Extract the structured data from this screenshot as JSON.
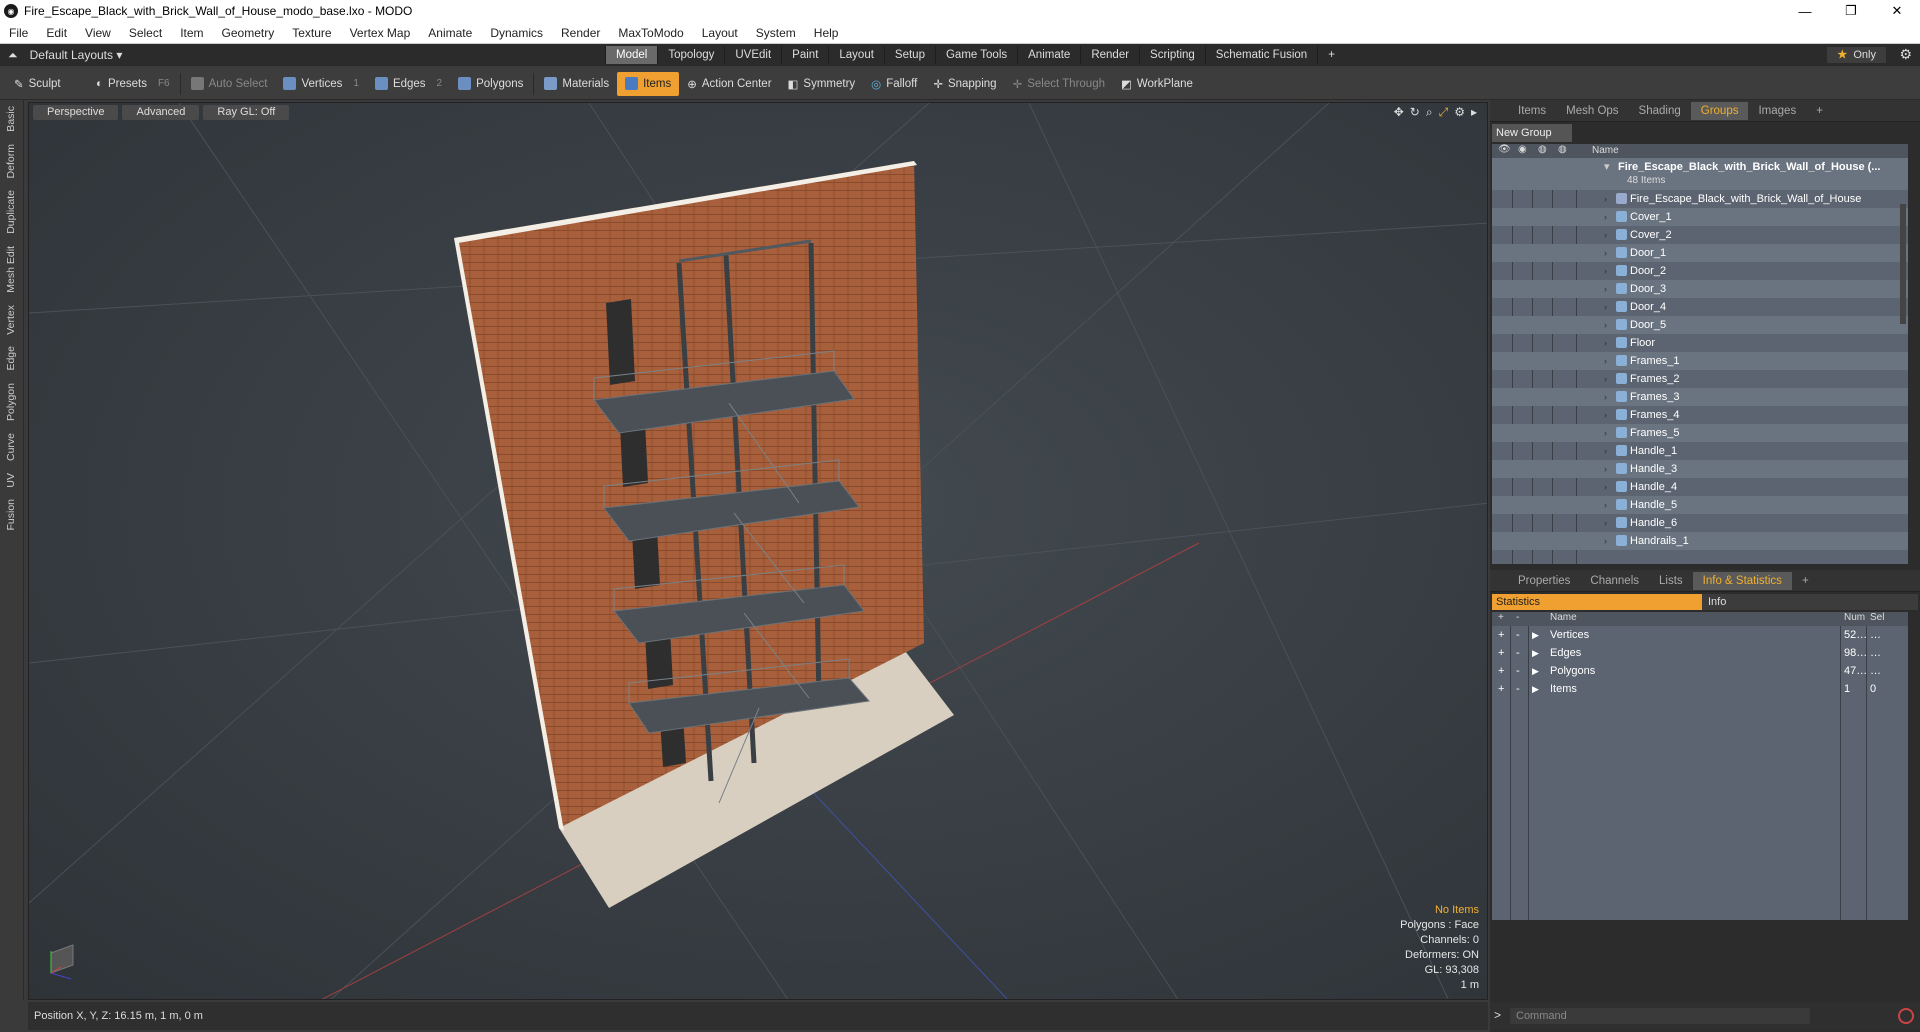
{
  "window": {
    "title": "Fire_Escape_Black_with_Brick_Wall_of_House_modo_base.lxo - MODO",
    "app_icon": "modo-icon",
    "controls": [
      "—",
      "❐",
      "✕"
    ]
  },
  "menu": [
    "File",
    "Edit",
    "View",
    "Select",
    "Item",
    "Geometry",
    "Texture",
    "Vertex Map",
    "Animate",
    "Dynamics",
    "Render",
    "MaxToModo",
    "Layout",
    "System",
    "Help"
  ],
  "layout": {
    "selector": "Default Layouts ▾",
    "tabs": [
      "Model",
      "Topology",
      "UVEdit",
      "Paint",
      "Layout",
      "Setup",
      "Game Tools",
      "Animate",
      "Render",
      "Scripting",
      "Schematic Fusion",
      "+"
    ],
    "active_tab": "Model",
    "only_label": "Only"
  },
  "toolbar": {
    "sculpt": "Sculpt",
    "presets": "Presets",
    "presets_key": "F6",
    "auto_select": "Auto Select",
    "vertices": "Vertices",
    "vertices_key": "1",
    "edges": "Edges",
    "edges_key": "2",
    "polygons": "Polygons",
    "materials": "Materials",
    "items": "Items",
    "action_center": "Action Center",
    "symmetry": "Symmetry",
    "falloff": "Falloff",
    "snapping": "Snapping",
    "select_through": "Select Through",
    "workplane": "WorkPlane"
  },
  "left_tabs": [
    "Basic",
    "Deform",
    "Duplicate",
    "Mesh Edit",
    "Vertex",
    "Edge",
    "Polygon",
    "Curve",
    "UV",
    "Fusion"
  ],
  "viewport": {
    "header": [
      "Perspective",
      "Advanced",
      "Ray GL: Off"
    ],
    "info": {
      "no_items": "No Items",
      "polygons": "Polygons : Face",
      "channels": "Channels: 0",
      "deformers": "Deformers: ON",
      "gl": "GL: 93,308",
      "scale": "1 m"
    }
  },
  "status": {
    "position": "Position X, Y, Z:   16.15 m, 1 m, 0 m"
  },
  "right_top": {
    "tabs": [
      "Items",
      "Mesh Ops",
      "Shading",
      "Groups",
      "Images",
      "+"
    ],
    "active_tab": "Groups",
    "new_group": "New Group",
    "name_col": "Name",
    "root": {
      "name": "Fire_Escape_Black_with_Brick_Wall_of_House (...",
      "count": "48 Items"
    },
    "items": [
      "Fire_Escape_Black_with_Brick_Wall_of_House",
      "Cover_1",
      "Cover_2",
      "Door_1",
      "Door_2",
      "Door_3",
      "Door_4",
      "Door_5",
      "Floor",
      "Frames_1",
      "Frames_2",
      "Frames_3",
      "Frames_4",
      "Frames_5",
      "Handle_1",
      "Handle_3",
      "Handle_4",
      "Handle_5",
      "Handle_6",
      "Handrails_1"
    ]
  },
  "right_bottom": {
    "tabs": [
      "Properties",
      "Channels",
      "Lists",
      "Info & Statistics",
      "+"
    ],
    "active_tab": "Info & Statistics",
    "sub_tabs": [
      "Statistics",
      "Info"
    ],
    "cols": [
      "Name",
      "Num",
      "Sel"
    ],
    "rows": [
      {
        "name": "Vertices",
        "num": "52…",
        "sel": "…"
      },
      {
        "name": "Edges",
        "num": "98…",
        "sel": "…"
      },
      {
        "name": "Polygons",
        "num": "47…",
        "sel": "…"
      },
      {
        "name": "Items",
        "num": "1",
        "sel": "0"
      }
    ],
    "command_prompt": ">",
    "command_placeholder": "Command"
  }
}
